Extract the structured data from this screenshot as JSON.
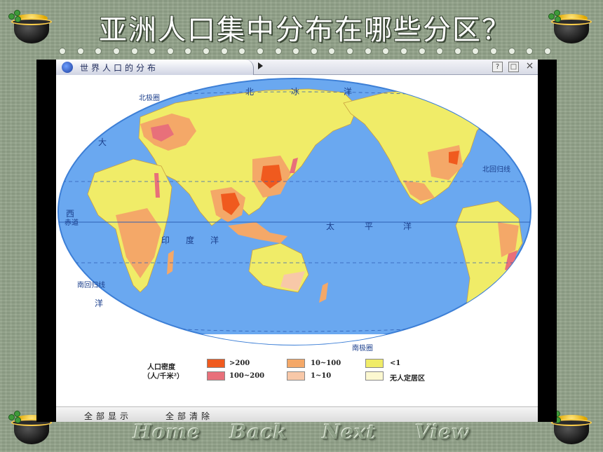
{
  "slide": {
    "title": "亚洲人口集中分布在哪些分区？"
  },
  "window": {
    "title": "世界人口的分布",
    "help_label": "?",
    "restore_label": "□",
    "close_label": "×",
    "show_all_label": "全部显示",
    "clear_all_label": "全部清除"
  },
  "map": {
    "labels": {
      "arctic_circle": "北极圈",
      "arctic_ocean_1": "北",
      "arctic_ocean_2": "冰",
      "arctic_ocean_3": "洋",
      "tropic_cancer": "北回归线",
      "equator": "赤道",
      "tropic_capricorn": "南回归线",
      "antarctic_circle": "南极圈",
      "pacific_1": "太",
      "pacific_2": "平",
      "pacific_3": "洋",
      "indian_1": "印",
      "indian_2": "度",
      "indian_3": "洋",
      "atlantic_1": "大",
      "atlantic_2": "西",
      "atlantic_3": "洋"
    },
    "colors": {
      "ocean": "#6aa8f0",
      "ocean_edge": "#3d7fd6",
      "very_high": "#f05a1e",
      "high": "#e8707a",
      "medium": "#f4a868",
      "low": "#f8c8a8",
      "very_low": "#f0ec68",
      "uninhabited": "#fcf8d0"
    }
  },
  "legend": {
    "title_line1": "人口密度",
    "title_line2": "（人/千米²）",
    "items": [
      {
        "label": ">200",
        "color": "#f05a1e"
      },
      {
        "label": "100~200",
        "color": "#e8707a"
      },
      {
        "label": "10~100",
        "color": "#f4a868"
      },
      {
        "label": "1~10",
        "color": "#f8c8a8"
      },
      {
        "label": "<1",
        "color": "#f0ec68"
      },
      {
        "label": "无人定居区",
        "color": "#fcf8d0"
      }
    ]
  },
  "nav": {
    "home": "Home",
    "back": "Back",
    "next": "Next",
    "view": "View"
  }
}
